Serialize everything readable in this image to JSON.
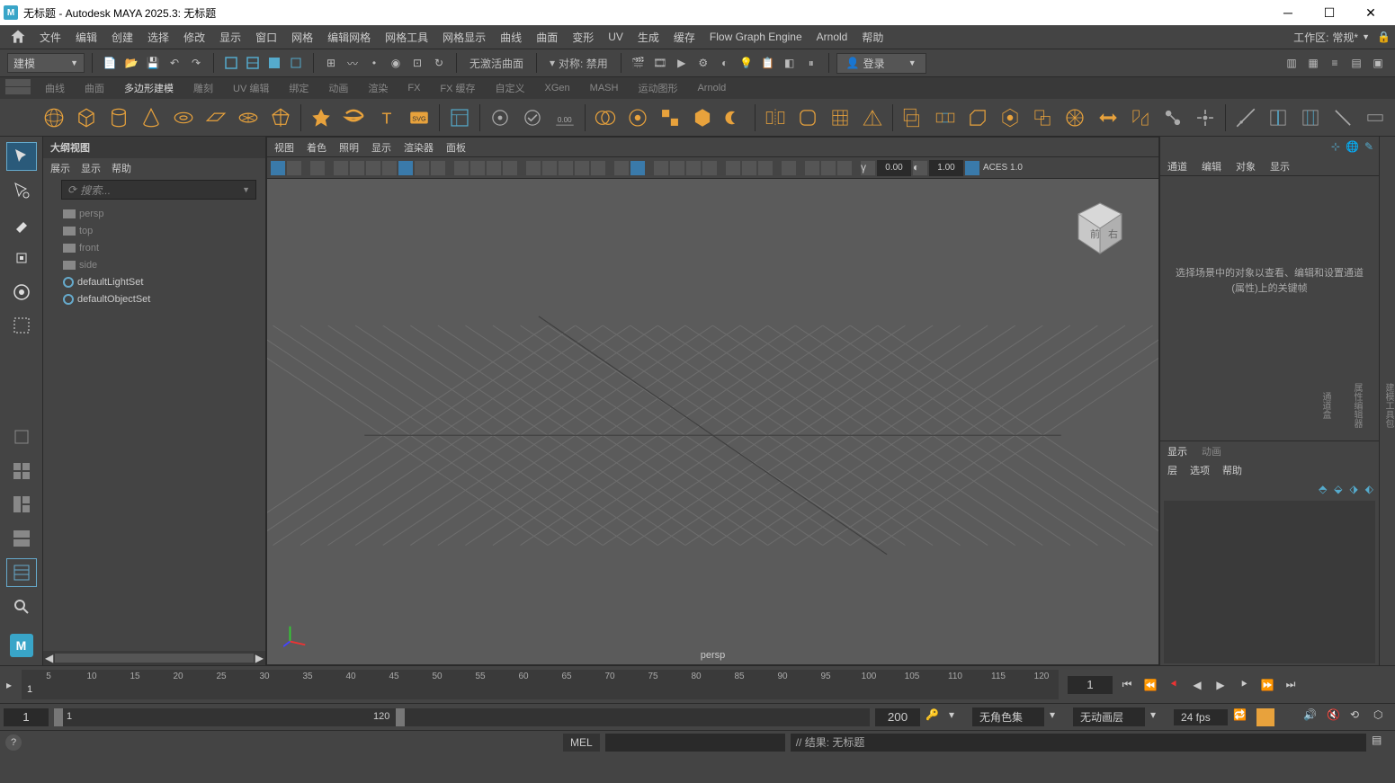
{
  "window": {
    "title": "无标题 - Autodesk MAYA 2025.3: 无标题"
  },
  "menu": {
    "items": [
      "文件",
      "编辑",
      "创建",
      "选择",
      "修改",
      "显示",
      "窗口",
      "网格",
      "编辑网格",
      "网格工具",
      "网格显示",
      "曲线",
      "曲面",
      "变形",
      "UV",
      "生成",
      "缓存",
      "Flow Graph Engine",
      "Arnold",
      "帮助"
    ],
    "workspace_label": "工作区:",
    "workspace_value": "常规*"
  },
  "toolbar": {
    "mode": "建模",
    "curve_label": "无激活曲面",
    "sym_label": "对称: 禁用",
    "login": "登录"
  },
  "shelf": {
    "tabs": [
      "曲线",
      "曲面",
      "多边形建模",
      "雕刻",
      "UV 编辑",
      "绑定",
      "动画",
      "渲染",
      "FX",
      "FX 缓存",
      "自定义",
      "XGen",
      "MASH",
      "运动图形",
      "Arnold"
    ],
    "active_tab": 2
  },
  "outliner": {
    "title": "大纲视图",
    "menu": [
      "展示",
      "显示",
      "帮助"
    ],
    "search": "搜索...",
    "items": [
      {
        "name": "persp",
        "type": "cam"
      },
      {
        "name": "top",
        "type": "cam"
      },
      {
        "name": "front",
        "type": "cam"
      },
      {
        "name": "side",
        "type": "cam"
      },
      {
        "name": "defaultLightSet",
        "type": "set"
      },
      {
        "name": "defaultObjectSet",
        "type": "set"
      }
    ]
  },
  "viewport": {
    "menu": [
      "视图",
      "着色",
      "照明",
      "显示",
      "渲染器",
      "面板"
    ],
    "gamma": "0.00",
    "exposure": "1.00",
    "colorspace": "ACES 1.0",
    "camera": "persp"
  },
  "right": {
    "tabs": [
      "通道",
      "编辑",
      "对象",
      "显示"
    ],
    "empty": "选择场景中的对象以查看、编辑和设置通道(属性)上的关键帧",
    "layer_tabs": [
      "显示",
      "动画"
    ],
    "layer_menu": [
      "层",
      "选项",
      "帮助"
    ]
  },
  "timeline": {
    "start": "1",
    "end": "200",
    "in": "1",
    "out": "120",
    "current": "1",
    "fps": "24 fps",
    "charset": "无角色集",
    "animlayer": "无动画层"
  },
  "cmd": {
    "lang": "MEL",
    "result": "// 结果: 无标题"
  }
}
